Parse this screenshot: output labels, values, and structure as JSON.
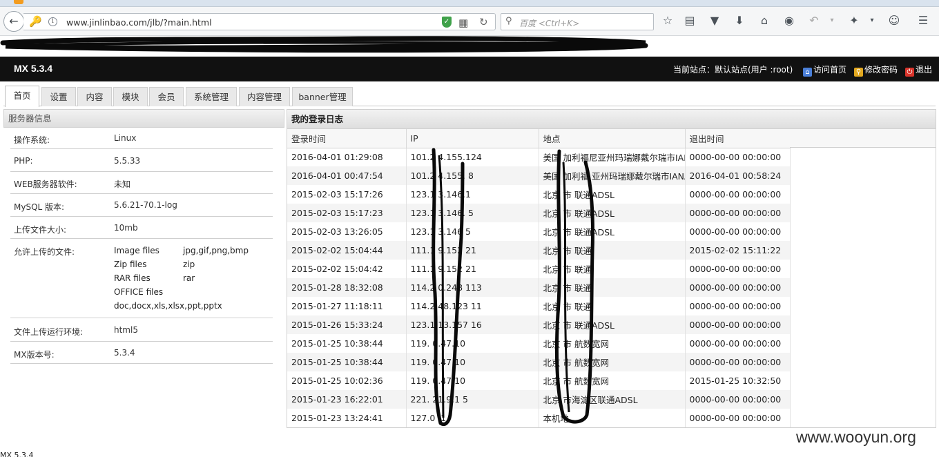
{
  "browser": {
    "url": "www.jinlinbao.com/jlb/?main.html",
    "search_placeholder": "百度 <Ctrl+K>"
  },
  "app": {
    "title": "MX 5.3.4",
    "site_info": "当前站点：默认站点(用户 :root)",
    "links": {
      "home": "访问首页",
      "password": "修改密码",
      "logout": "退出"
    }
  },
  "tabs": [
    "首页",
    "设置",
    "内容",
    "模块",
    "会员",
    "系统管理",
    "内容管理",
    "banner管理"
  ],
  "server": {
    "heading": "服务器信息",
    "os_label": "操作系统:",
    "os_value": "Linux",
    "php_label": "PHP:",
    "php_value": "5.5.33",
    "web_label": "WEB服务器软件:",
    "web_value": "未知",
    "mysql_label": "MySQL 版本:",
    "mysql_value": "5.6.21-70.1-log",
    "upload_size_label": "上传文件大小:",
    "upload_size_value": "10mb",
    "allowed_label": "允许上传的文件:",
    "file_types": [
      {
        "name": "Image files",
        "ext": "jpg,gif,png,bmp"
      },
      {
        "name": "Zip files",
        "ext": "zip"
      },
      {
        "name": "RAR files",
        "ext": "rar"
      },
      {
        "name": "OFFICE files",
        "ext": ""
      },
      {
        "name": "doc,docx,xls,xlsx,ppt,pptx",
        "ext": ""
      }
    ],
    "env_label": "文件上传运行环境:",
    "env_value": "html5",
    "version_label": "MX版本号:",
    "version_value": "5.3.4"
  },
  "log": {
    "heading": "我的登录日志",
    "columns": [
      "登录时间",
      "IP",
      "地点",
      "退出时间"
    ],
    "rows": [
      [
        "2016-04-01 01:29:08",
        "101.2 4.155.124",
        "美国 加利福尼亚州玛瑞娜戴尔瑞市IANA",
        "0000-00-00 00:00:00"
      ],
      [
        "2016-04-01 00:47:54",
        "101.2 4.155. 8",
        "美国 加利福 亚州玛瑞娜戴尔瑞市IANA",
        "2016-04-01 00:58:24"
      ],
      [
        "2015-02-03 15:17:26",
        "123.1 3.146.1",
        "北京 市 联通ADSL",
        "0000-00-00 00:00:00"
      ],
      [
        "2015-02-03 15:17:23",
        "123.1 3.146. 5",
        "北京 市 联通ADSL",
        "0000-00-00 00:00:00"
      ],
      [
        "2015-02-03 13:26:05",
        "123.1 3.146 5",
        "北京 市 联通ADSL",
        "0000-00-00 00:00:00"
      ],
      [
        "2015-02-02 15:04:44",
        "111.1 9.152 21",
        "北京 市 联通",
        "2015-02-02 15:11:22"
      ],
      [
        "2015-02-02 15:04:42",
        "111.1 9.152 21",
        "北京 市 联通",
        "0000-00-00 00:00:00"
      ],
      [
        "2015-01-28 18:32:08",
        "114.2 0.248 113",
        "北京 市 联通",
        "0000-00-00 00:00:00"
      ],
      [
        "2015-01-27 11:18:11",
        "114.2 48.123 11",
        "北京 市 联通",
        "0000-00-00 00:00:00"
      ],
      [
        "2015-01-26 15:33:24",
        "123.1 13.157 16",
        "北京 市 联通ADSL",
        "0000-00-00 00:00:00"
      ],
      [
        "2015-01-25 10:38:44",
        "119. 0.47.10",
        "北京 市 航数宽网",
        "0000-00-00 00:00:00"
      ],
      [
        "2015-01-25 10:38:44",
        "119. 0.47.10",
        "北京 市 航数宽网",
        "0000-00-00 00:00:00"
      ],
      [
        "2015-01-25 10:02:36",
        "119. 0.47.10",
        "北京 市 航数宽网",
        "2015-01-25 10:32:50"
      ],
      [
        "2015-01-23 16:22:01",
        "221. 21.9.1 5",
        "北京 市海淀区联通ADSL",
        "0000-00-00 00:00:00"
      ],
      [
        "2015-01-23 13:24:41",
        "127.0 .1",
        "本机地",
        "0000-00-00 00:00:00"
      ]
    ]
  },
  "watermark": "www.wooyun.org",
  "status_text": "MX 5.3.4"
}
